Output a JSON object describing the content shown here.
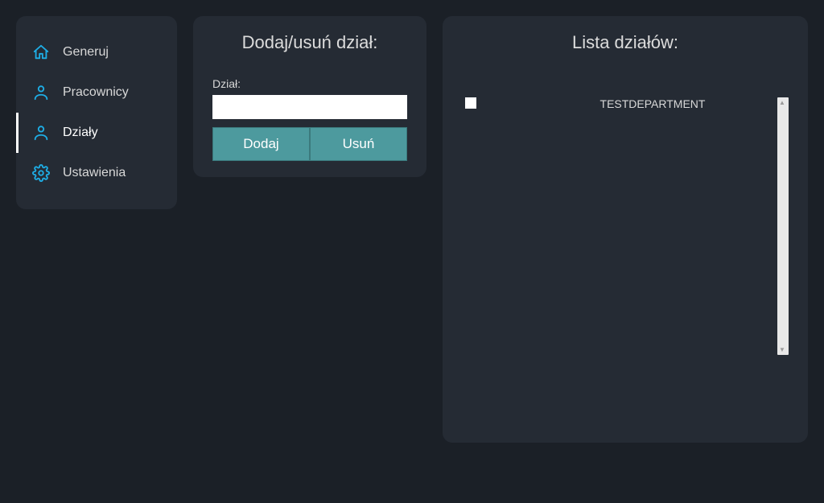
{
  "sidebar": {
    "items": [
      {
        "label": "Generuj",
        "icon": "home",
        "active": false
      },
      {
        "label": "Pracownicy",
        "icon": "person",
        "active": false
      },
      {
        "label": "Działy",
        "icon": "person",
        "active": true
      },
      {
        "label": "Ustawienia",
        "icon": "gear",
        "active": false
      }
    ]
  },
  "form_panel": {
    "title": "Dodaj/usuń dział:",
    "field_label": "Dział:",
    "input_value": "",
    "add_label": "Dodaj",
    "remove_label": "Usuń"
  },
  "list_panel": {
    "title": "Lista działów:",
    "rows": [
      {
        "checked": false,
        "name": "TESTDEPARTMENT"
      }
    ]
  },
  "colors": {
    "accent": "#4d9a9e",
    "icon_accent": "#1eaee6",
    "bg": "#1b2027",
    "panel": "#252b34"
  }
}
